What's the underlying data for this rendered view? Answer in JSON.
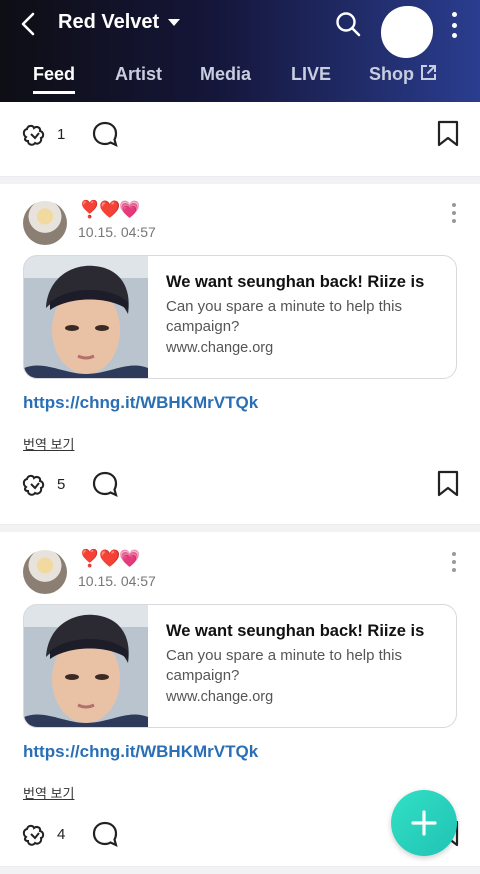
{
  "header": {
    "title": "Red Velvet",
    "tabs": [
      {
        "label": "Feed",
        "active": true
      },
      {
        "label": "Artist",
        "active": false
      },
      {
        "label": "Media",
        "active": false
      },
      {
        "label": "LIVE",
        "active": false
      },
      {
        "label": "Shop",
        "active": false,
        "icon": "external-link-icon"
      }
    ],
    "icons": [
      "back-arrow-icon",
      "caret-down-icon",
      "search-icon",
      "more-vertical-icon"
    ]
  },
  "top_post_actions": {
    "reaction_count": "1"
  },
  "posts": [
    {
      "reaction_emoji": "❣️❤️💗",
      "time": "10.15. 04:57",
      "link_card": {
        "title": "We want seunghan back! Riize is",
        "description": "Can you spare a minute to help this campaign?",
        "domain": "www.change.org"
      },
      "link": "https://chng.it/WBHKMrVTQk",
      "translate_label": "번역 보기",
      "reaction_count": "5"
    },
    {
      "reaction_emoji": "❣️❤️💗",
      "time": "10.15. 04:57",
      "link_card": {
        "title": "We want seunghan back! Riize is",
        "description": "Can you spare a minute to help this campaign?",
        "domain": "www.change.org"
      },
      "link": "https://chng.it/WBHKMrVTQk",
      "translate_label": "번역 보기",
      "reaction_count": "4"
    }
  ],
  "fab": {
    "icon": "plus-icon"
  },
  "colors": {
    "accent_link": "#2a6fb6",
    "fab": "#25cdb9",
    "header_end": "#2a3d8f"
  }
}
